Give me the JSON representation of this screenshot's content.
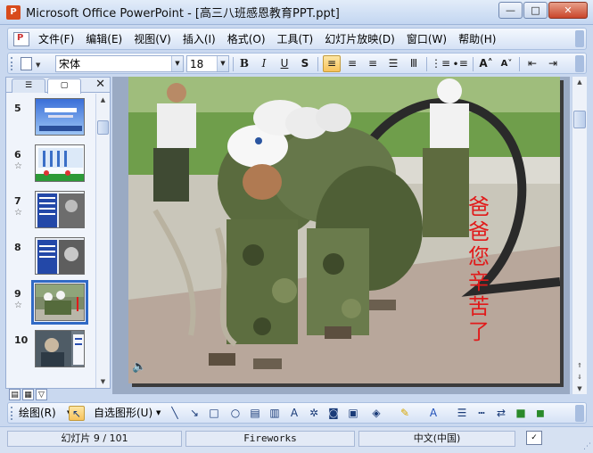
{
  "window": {
    "title": "Microsoft Office PowerPoint - [高三八班感恩教育PPT.ppt]"
  },
  "menu": [
    "文件(F)",
    "编辑(E)",
    "视图(V)",
    "插入(I)",
    "格式(O)",
    "工具(T)",
    "幻灯片放映(D)",
    "窗口(W)",
    "帮助(H)"
  ],
  "format_toolbar": {
    "font_name": "宋体",
    "font_size": "18"
  },
  "slides": [
    {
      "num": "5",
      "has_star": false
    },
    {
      "num": "6",
      "has_star": true
    },
    {
      "num": "7",
      "has_star": true
    },
    {
      "num": "8",
      "has_star": false
    },
    {
      "num": "9",
      "has_star": true,
      "selected": true
    },
    {
      "num": "10",
      "has_star": false
    }
  ],
  "current_slide": {
    "caption": "爸爸您辛苦了"
  },
  "draw_toolbar": {
    "draw_label": "绘图(R)",
    "autoshape_label": "自选图形(U)"
  },
  "status": {
    "slide_info": "幻灯片 9 / 101",
    "design": "Fireworks",
    "language": "中文(中国)"
  },
  "colors": {
    "accent": "#316ac5",
    "caption_red": "#e11a1a"
  }
}
